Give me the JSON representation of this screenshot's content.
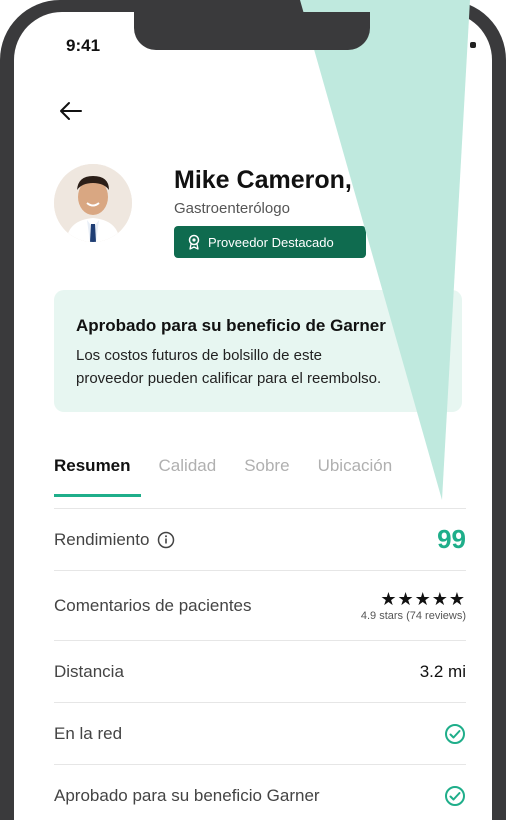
{
  "status_bar": {
    "time": "9:41"
  },
  "provider": {
    "name": "Mike Cameron, MD",
    "specialty": "Gastroenterólogo",
    "badge": "Proveedor Destacado"
  },
  "benefit": {
    "title": "Aprobado para su beneficio de Garner",
    "line1": "Los costos futuros de bolsillo de este",
    "line2": "proveedor pueden calificar para el reembolso."
  },
  "tabs": [
    {
      "label": "Resumen",
      "active": true
    },
    {
      "label": "Calidad",
      "active": false
    },
    {
      "label": "Sobre",
      "active": false
    },
    {
      "label": "Ubicación",
      "active": false
    }
  ],
  "rows": {
    "performance": {
      "label": "Rendimiento",
      "value": "99"
    },
    "reviews": {
      "label": "Comentarios de pacientes",
      "stars": "★★★★★",
      "sub": "4.9 stars (74 reviews)"
    },
    "distance": {
      "label": "Distancia",
      "value": "3.2 mi"
    },
    "in_network": {
      "label": "En la red"
    },
    "approved": {
      "label": "Aprobado para su beneficio Garner"
    }
  },
  "colors": {
    "accent": "#1fae8a",
    "badge": "#0f6b4f",
    "card": "#e7f6f1",
    "callout": "#bfe9de"
  }
}
